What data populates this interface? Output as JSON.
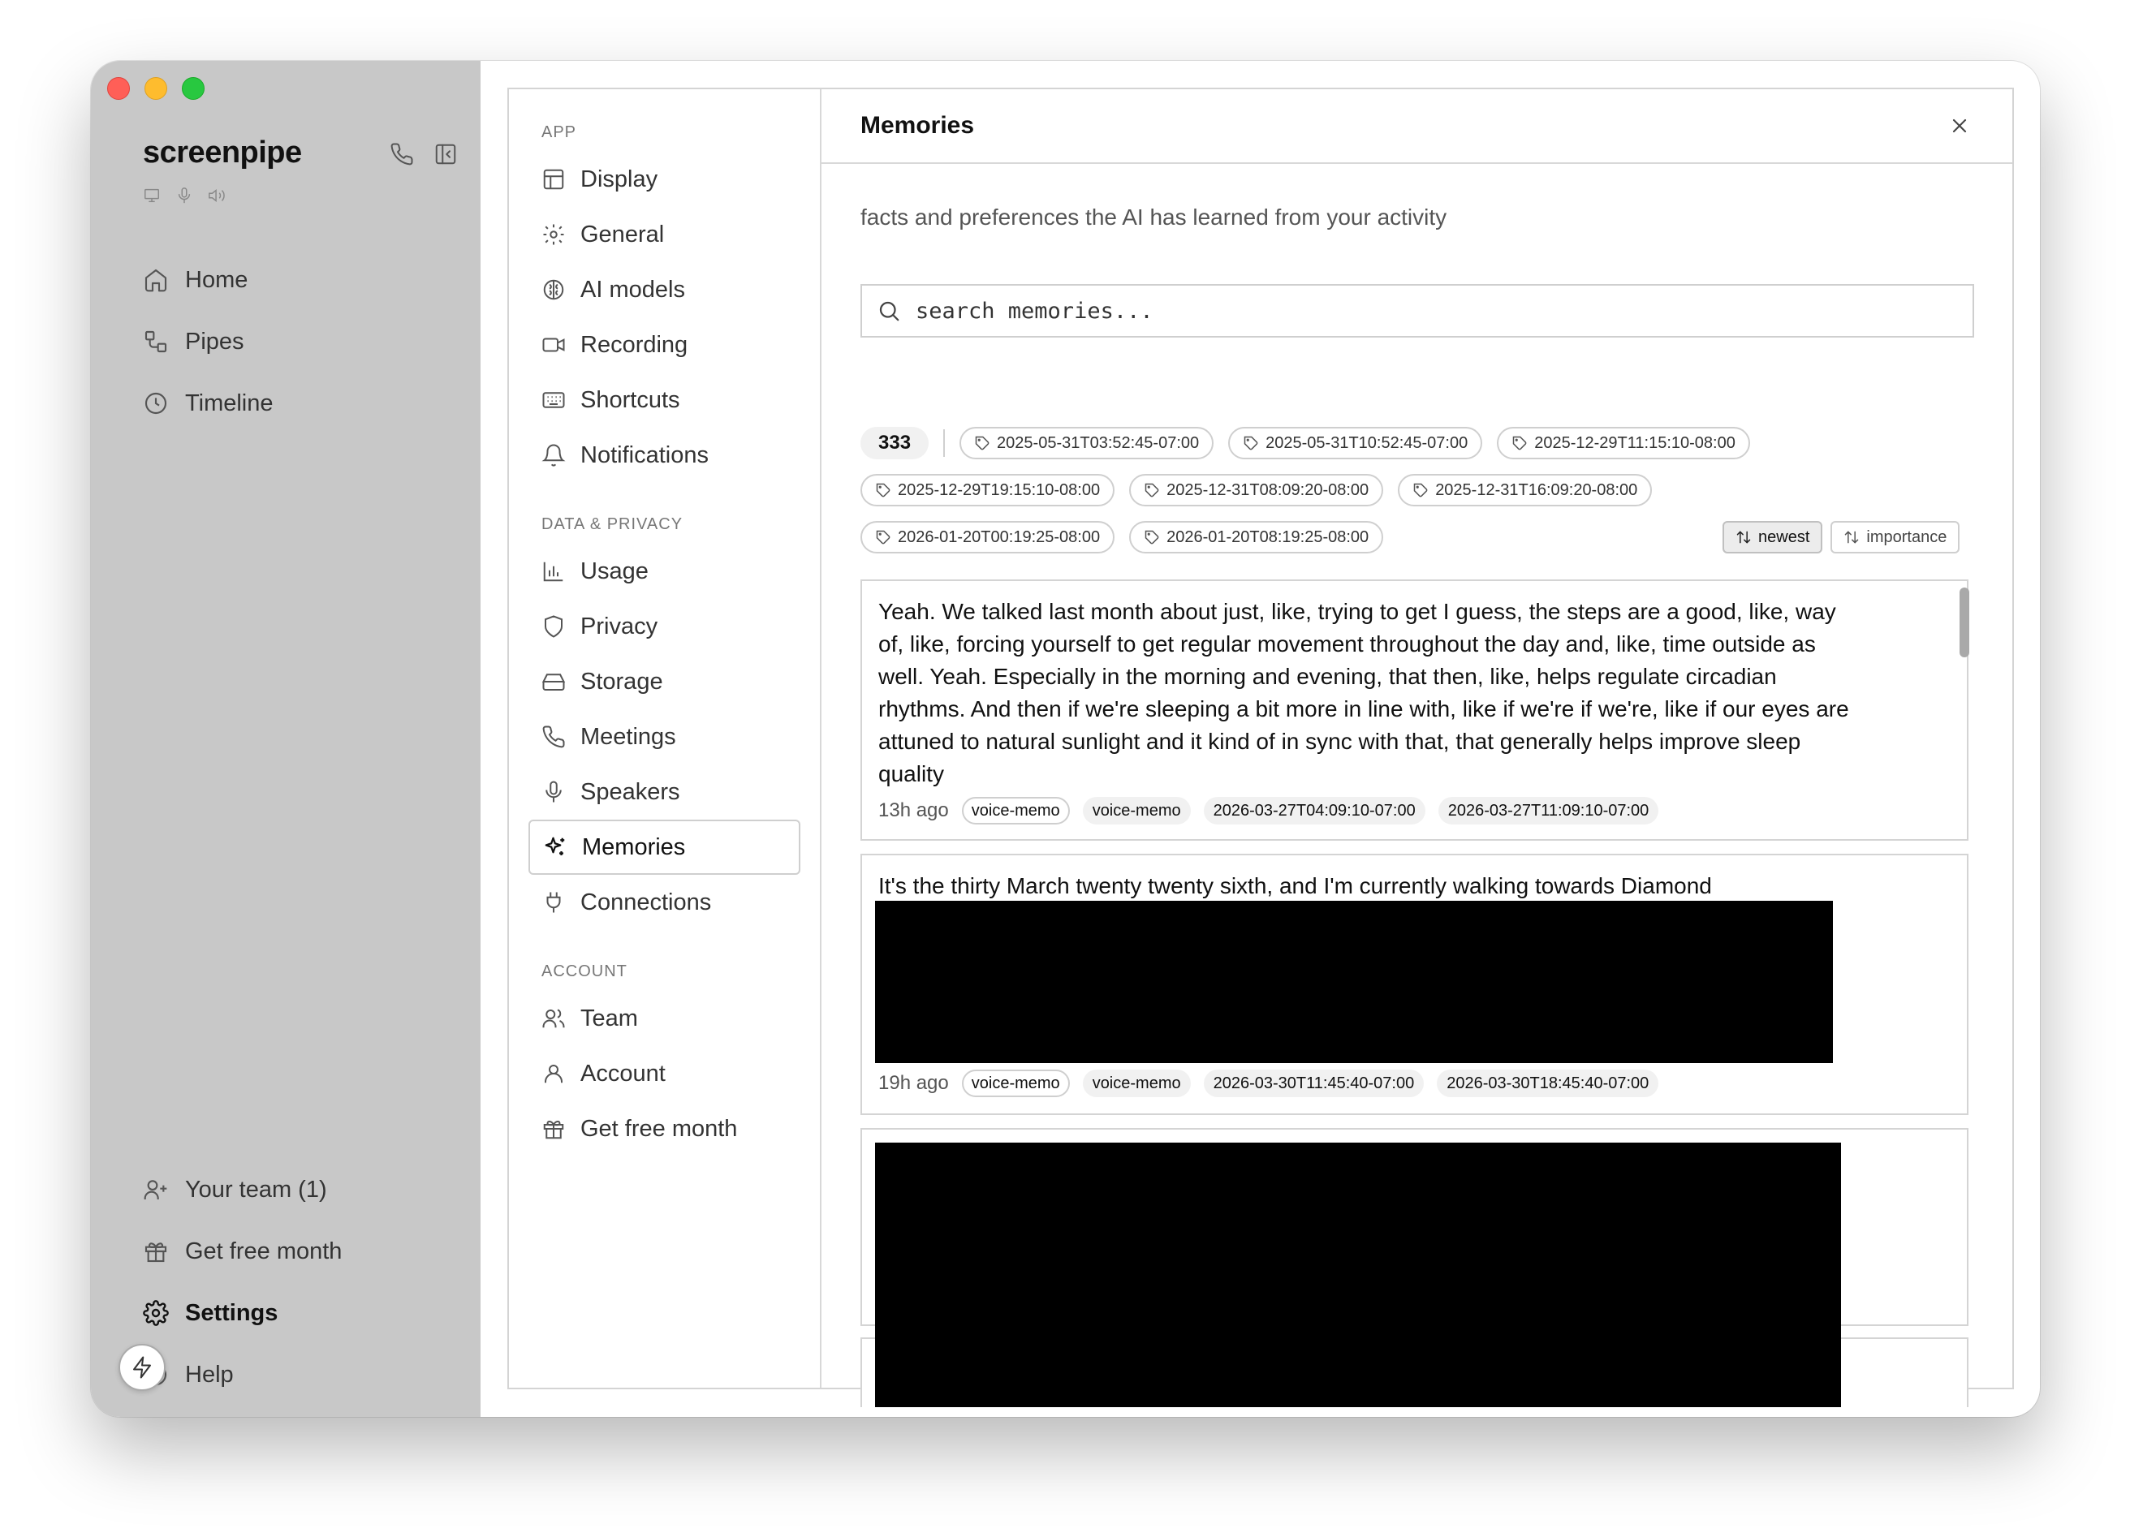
{
  "app": {
    "name": "screenpipe"
  },
  "sidebar": {
    "nav": [
      {
        "label": "Home"
      },
      {
        "label": "Pipes"
      },
      {
        "label": "Timeline"
      }
    ],
    "bottom": [
      {
        "label": "Your team (1)"
      },
      {
        "label": "Get free month"
      },
      {
        "label": "Settings"
      },
      {
        "label": "Help"
      }
    ]
  },
  "settings_nav": {
    "app_section": "APP",
    "app_items": [
      "Display",
      "General",
      "AI models",
      "Recording",
      "Shortcuts",
      "Notifications"
    ],
    "data_section": "DATA & PRIVACY",
    "data_items": [
      "Usage",
      "Privacy",
      "Storage",
      "Meetings",
      "Speakers",
      "Memories",
      "Connections"
    ],
    "account_section": "ACCOUNT",
    "account_items": [
      "Team",
      "Account",
      "Get free month"
    ],
    "active": "Memories"
  },
  "memories": {
    "title": "Memories",
    "subtitle": "facts and preferences the AI has learned from your activity",
    "search_placeholder": "search memories...",
    "count": "333",
    "tags": [
      "2025-05-31T03:52:45-07:00",
      "2025-05-31T10:52:45-07:00",
      "2025-12-29T11:15:10-08:00",
      "2025-12-29T19:15:10-08:00",
      "2025-12-31T08:09:20-08:00",
      "2025-12-31T16:09:20-08:00",
      "2026-01-20T00:19:25-08:00",
      "2026-01-20T08:19:25-08:00"
    ],
    "sort": {
      "newest": "newest",
      "importance": "importance",
      "active": "newest"
    },
    "items": [
      {
        "text": "Yeah. We talked last month about just, like, trying to get I guess, the steps are a good, like, way of, like, forcing yourself to get regular movement throughout the day and, like, time outside as well. Yeah. Especially in the morning and evening, that then, like, helps regulate circadian rhythms. And then if we're sleeping a bit more in line with, like if we're if we're, like if our eyes are attuned to natural sunlight and it kind of in sync with that, that generally helps improve sleep quality",
        "ago": "13h ago",
        "chips": [
          "voice-memo",
          "voice-memo",
          "2026-03-27T04:09:10-07:00",
          "2026-03-27T11:09:10-07:00"
        ]
      },
      {
        "text": "It's the thirty March twenty twenty sixth, and I'm currently walking towards Diamond",
        "ago": "19h ago",
        "chips": [
          "voice-memo",
          "voice-memo",
          "2026-03-30T11:45:40-07:00",
          "2026-03-30T18:45:40-07:00"
        ]
      }
    ]
  }
}
